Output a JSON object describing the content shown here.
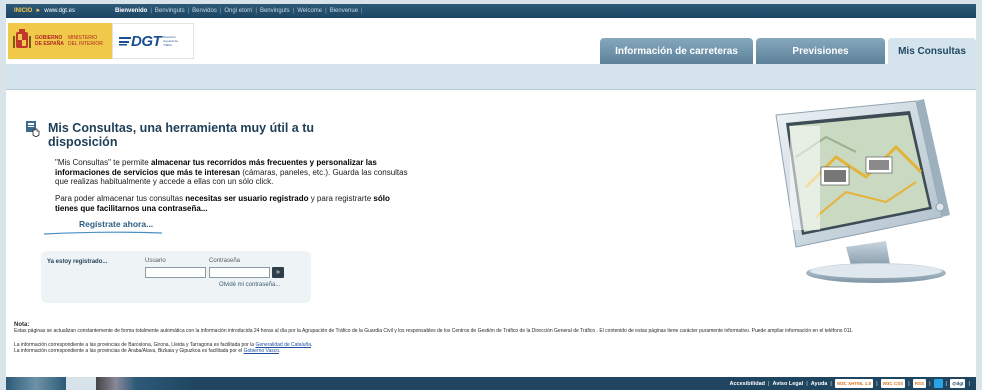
{
  "topbar": {
    "inicio": "INICIO",
    "url": "www.dgt.es",
    "welcome": "Bienvenido",
    "languages": [
      "Benvinguts",
      "Benvidos",
      "Ongi etorri",
      "Benvinguts",
      "Welcome",
      "Bienvenue"
    ]
  },
  "header": {
    "gobierno_line1": "GOBIERNO DE ESPAÑA",
    "gobierno_line2": "MINISTERIO DEL INTERIOR",
    "dgt_logo": "DGT",
    "dgt_sub": "Dirección General de Tráfico",
    "tabs": [
      {
        "label": "Información de carreteras"
      },
      {
        "label": "Previsiones"
      },
      {
        "label": "Mis Consultas"
      }
    ]
  },
  "main": {
    "title": "Mis Consultas, una herramienta muy útil a tu disposición",
    "p1_a": "\"Mis Consultas\" te permite ",
    "p1_b": "almacenar tus recorridos más frecuentes y personalizar las informaciones de servicios que más te interesan",
    "p1_c": " (cámaras, paneles, etc.). Guarda las consultas que realizas habitualmente y accede a ellas con un sólo click.",
    "p2_a": "Para poder almacenar tus consultas ",
    "p2_b": "necesitas ser usuario registrado",
    "p2_c": " y para registrarte ",
    "p2_d": "sólo tienes que facilitarnos una contraseña...",
    "registrate": "Regístrate ahora..."
  },
  "login": {
    "ya_registrado": "Ya estoy registrado...",
    "usuario_label": "Usuario",
    "contrasena_label": "Contraseña",
    "usuario_value": "",
    "contrasena_value": "",
    "go": "»",
    "olvide": "Olvidé mi contraseña..."
  },
  "nota": {
    "label": "Nota:",
    "text": "Estas páginas se actualizan constantemente de forma totalmente automática con la información introducida 24 horas al día por la Agrupación de Tráfico de la Guardia Civil y los responsables de los Centros de Gestión de Tráfico de la Dirección General de Tráfico . El contenido de estas páginas tiene carácter puramente informativo. Puede ampliar información en el teléfono 011.",
    "line1_a": "La información correspondiente a las provincias de Barcelona, Girona, Lleida y Tarragona es facilitada por la ",
    "line1_link": "Generalidad de Cataluña",
    "line1_b": ".",
    "line2_a": "La información correspondiente a las provincias de Araba/Alava, Bizkaia y Gipuzkoa es facilitada por el ",
    "line2_link": "Gobierno Vasco",
    "line2_b": "."
  },
  "footer": {
    "accesibilidad": "Accesibilidad",
    "aviso": "Aviso Legal",
    "ayuda": "Ayuda",
    "badge_w3c_xhtml": "W3C XHTML 1.0",
    "badge_w3c_css": "W3C CSS",
    "badge_rss": "RSS",
    "badge_last": "@dgt"
  },
  "colors": {
    "topbar": "#1e4663",
    "tab": "#5c8199",
    "tab_active": "#d4e3ec",
    "subbar": "#d4e3ec",
    "title": "#1e3f57",
    "link": "#2b5e84"
  }
}
